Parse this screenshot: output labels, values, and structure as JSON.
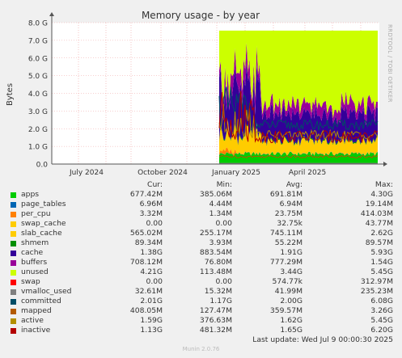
{
  "chart_data": {
    "type": "area",
    "title": "Memory usage - by year",
    "ylabel": "Bytes",
    "xlabel": "",
    "yticks": [
      "0.0",
      "1.0 G",
      "2.0 G",
      "3.0 G",
      "4.0 G",
      "5.0 G",
      "6.0 G",
      "7.0 G",
      "8.0 G"
    ],
    "ylim": [
      0,
      8000000000
    ],
    "xticks": [
      "July 2024",
      "October 2024",
      "January 2025",
      "April 2025"
    ],
    "grid": true,
    "data_start": "January 2025",
    "series": [
      {
        "name": "apps",
        "color": "#00cc00",
        "cur": "677.42M",
        "min": "385.06M",
        "avg": "691.81M",
        "max": "4.30G"
      },
      {
        "name": "page_tables",
        "color": "#0066b3",
        "cur": "6.96M",
        "min": "4.44M",
        "avg": "6.94M",
        "max": "19.14M"
      },
      {
        "name": "per_cpu",
        "color": "#ff8000",
        "cur": "3.32M",
        "min": "1.34M",
        "avg": "23.75M",
        "max": "414.03M"
      },
      {
        "name": "swap_cache",
        "color": "#ffcc00",
        "cur": "0.00",
        "min": "0.00",
        "avg": "32.75k",
        "max": "43.77M"
      },
      {
        "name": "slab_cache",
        "color": "#ffcc00",
        "cur": "565.02M",
        "min": "255.17M",
        "avg": "745.11M",
        "max": "2.62G"
      },
      {
        "name": "shmem",
        "color": "#008f00",
        "cur": "89.34M",
        "min": "3.93M",
        "avg": "55.22M",
        "max": "89.57M"
      },
      {
        "name": "cache",
        "color": "#330099",
        "cur": "1.38G",
        "min": "883.54M",
        "avg": "1.91G",
        "max": "5.93G"
      },
      {
        "name": "buffers",
        "color": "#990099",
        "cur": "708.12M",
        "min": "76.80M",
        "avg": "777.29M",
        "max": "1.54G"
      },
      {
        "name": "unused",
        "color": "#ccff00",
        "cur": "4.21G",
        "min": "113.48M",
        "avg": "3.44G",
        "max": "5.45G"
      },
      {
        "name": "swap",
        "color": "#ff0000",
        "cur": "0.00",
        "min": "0.00",
        "avg": "574.77k",
        "max": "312.97M"
      },
      {
        "name": "vmalloc_used",
        "color": "#808080",
        "cur": "32.61M",
        "min": "15.32M",
        "avg": "41.99M",
        "max": "235.23M"
      },
      {
        "name": "committed",
        "color": "#004d66",
        "cur": "2.01G",
        "min": "1.17G",
        "avg": "2.00G",
        "max": "6.08G"
      },
      {
        "name": "mapped",
        "color": "#b35a00",
        "cur": "408.05M",
        "min": "127.47M",
        "avg": "359.57M",
        "max": "3.26G"
      },
      {
        "name": "active",
        "color": "#b38f00",
        "cur": "1.59G",
        "min": "376.63M",
        "avg": "1.62G",
        "max": "5.45G"
      },
      {
        "name": "inactive",
        "color": "#b30000",
        "cur": "1.13G",
        "min": "481.32M",
        "avg": "1.65G",
        "max": "6.20G"
      }
    ]
  },
  "legend": {
    "headers": {
      "cur": "Cur:",
      "min": "Min:",
      "avg": "Avg:",
      "max": "Max:"
    }
  },
  "footer": {
    "last_update": "Last update:  Wed Jul  9 00:00:30 2025",
    "munin": "Munin 2.0.76"
  },
  "side_text": "RRDTOOL / TOBI OETIKER"
}
